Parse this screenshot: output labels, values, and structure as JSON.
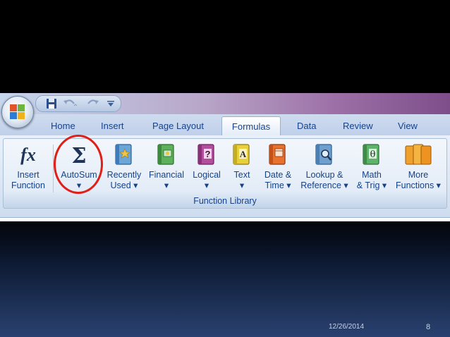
{
  "ribbon": {
    "tabs": [
      "Home",
      "Insert",
      "Page Layout",
      "Formulas",
      "Data",
      "Review",
      "View"
    ],
    "active_tab": "Formulas",
    "buttons": {
      "insert_function": {
        "icon_text": "fx",
        "line1": "Insert",
        "line2": "Function"
      },
      "autosum": {
        "icon_text": "Σ",
        "line1": "AutoSum",
        "line2": "▾"
      },
      "recently_used": {
        "line1": "Recently",
        "line2": "Used ▾"
      },
      "financial": {
        "line1": "Financial",
        "line2": "▾"
      },
      "logical": {
        "icon_text": "?",
        "line1": "Logical",
        "line2": "▾"
      },
      "text": {
        "icon_text": "A",
        "line1": "Text",
        "line2": "▾"
      },
      "date_time": {
        "line1": "Date &",
        "line2": "Time ▾"
      },
      "lookup_reference": {
        "line1": "Lookup &",
        "line2": "Reference ▾"
      },
      "math_trig": {
        "icon_text": "θ",
        "line1": "Math",
        "line2": "& Trig ▾"
      },
      "more_functions": {
        "line1": "More",
        "line2": "Functions ▾"
      }
    },
    "group_label": "Function Library"
  },
  "slide": {
    "date": "12/26/2014",
    "page_number": "8"
  },
  "colors": {
    "label_text": "#15428b",
    "highlight_circle": "#e02018"
  }
}
